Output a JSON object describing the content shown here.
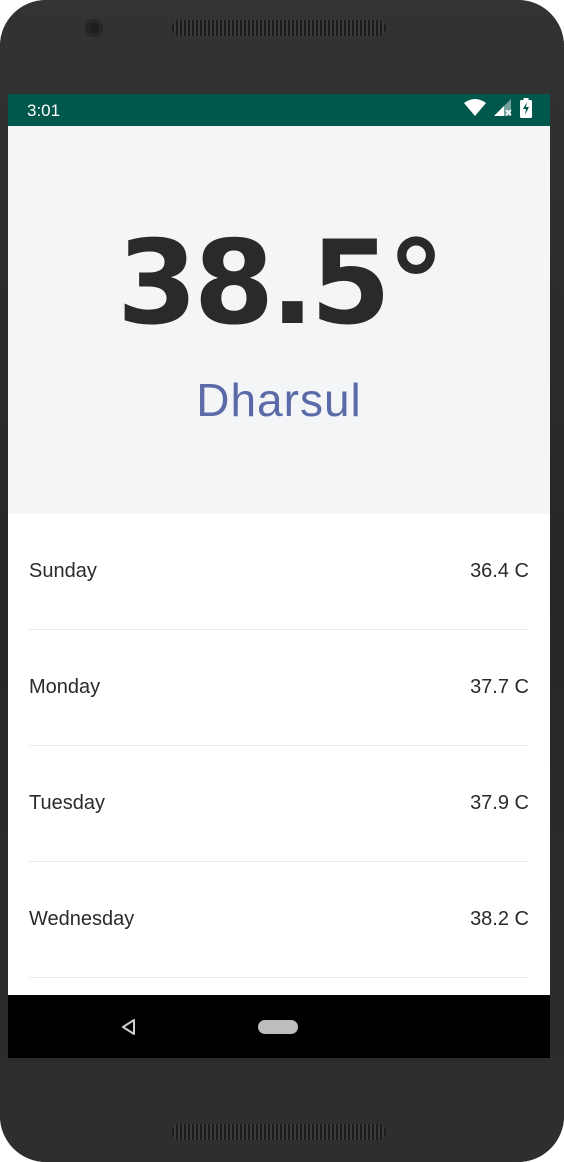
{
  "status_bar": {
    "time": "3:01",
    "background_color": "#00574b",
    "icons": [
      "wifi-icon",
      "signal-icon",
      "battery-charging-icon"
    ]
  },
  "weather": {
    "current_temp": "38.5°",
    "city": "Dharsul",
    "city_color": "#5b6ba8"
  },
  "forecast": [
    {
      "day": "Sunday",
      "temp": "36.4 C"
    },
    {
      "day": "Monday",
      "temp": "37.7 C"
    },
    {
      "day": "Tuesday",
      "temp": "37.9 C"
    },
    {
      "day": "Wednesday",
      "temp": "38.2 C"
    }
  ],
  "nav_bar": {
    "icons": [
      "back-icon",
      "home-icon"
    ]
  }
}
